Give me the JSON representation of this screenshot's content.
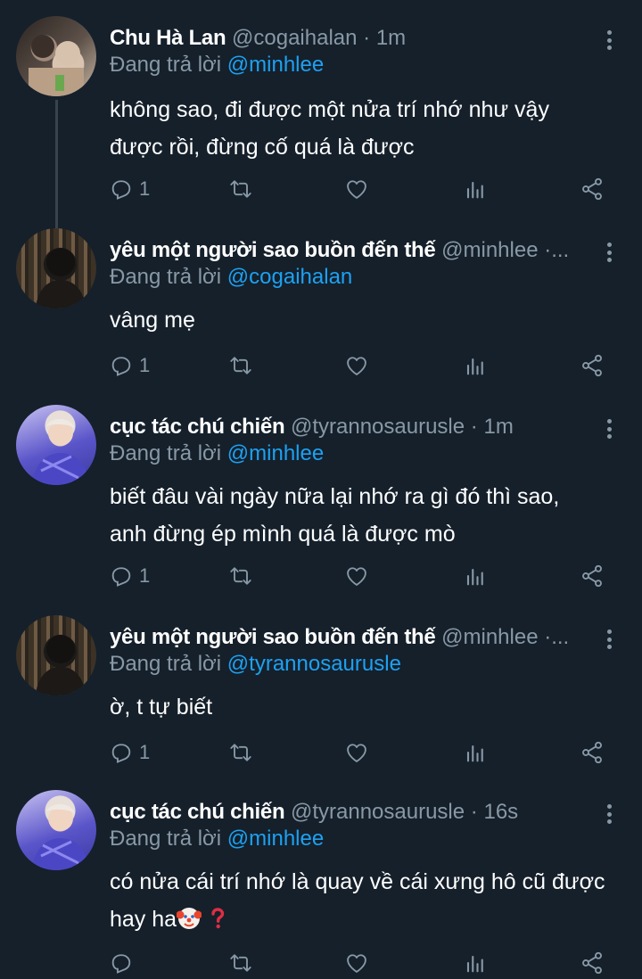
{
  "colors": {
    "background": "#15202b",
    "text": "#ffffff",
    "muted": "#8899a6",
    "mention": "#1da1f2",
    "thread_line": "#38444d"
  },
  "replying_label": "Đang trả lời",
  "dot": "·",
  "tweets": [
    {
      "display_name": "Chu Hà Lan",
      "handle": "@cogaihalan",
      "time": "1m",
      "reply_to": "@minhlee",
      "lines": [
        "không sao, đi được một nửa trí nhớ như vậy",
        "được rồi, đừng cố quá là được"
      ],
      "reply_count": "1",
      "avatar": "photo-group-icon"
    },
    {
      "display_name": "yêu một người sao buồn đến thế",
      "handle": "@minhlee",
      "time": "",
      "truncation": "...",
      "reply_to": "@cogaihalan",
      "lines": [
        "vâng mẹ"
      ],
      "reply_count": "1",
      "avatar": "photo-dark-icon"
    },
    {
      "display_name": "cục tác chú chiến",
      "handle": "@tyrannosaurusle",
      "time": "1m",
      "reply_to": "@minhlee",
      "lines": [
        "biết đâu vài ngày nữa lại nhớ ra gì đó thì sao,",
        "anh đừng ép mình quá là được mò"
      ],
      "reply_count": "1",
      "avatar": "photo-person-icon"
    },
    {
      "display_name": "yêu một người sao buồn đến thế",
      "handle": "@minhlee",
      "time": "",
      "truncation": "...",
      "reply_to": "@tyrannosaurusle",
      "lines": [
        "ờ, t tự biết"
      ],
      "reply_count": "1",
      "avatar": "photo-dark-icon"
    },
    {
      "display_name": "cục tác chú chiến",
      "handle": "@tyrannosaurusle",
      "time": "16s",
      "reply_to": "@minhlee",
      "lines": [
        "có nửa cái trí nhớ là quay về cái xưng hô cũ được",
        "hay ha"
      ],
      "trailing_emojis": [
        "clown-face-icon",
        "red-question-mark-icon"
      ],
      "reply_count": "",
      "avatar": "photo-person-icon"
    }
  ]
}
